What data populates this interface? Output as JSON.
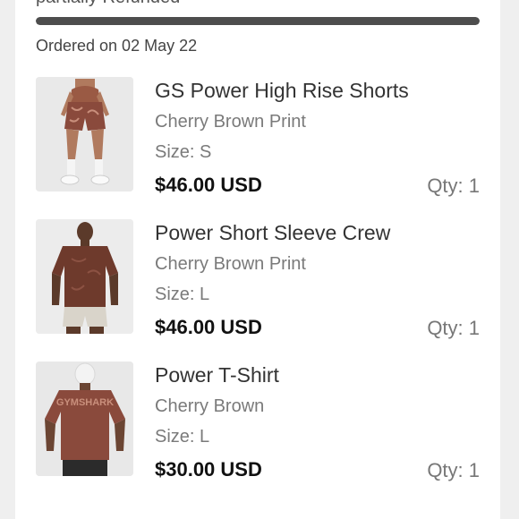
{
  "order": {
    "status_label": "partially Refunded",
    "progress_fraction": 1.0,
    "ordered_on": "Ordered on 02 May 22"
  },
  "items": [
    {
      "name": "GS Power High Rise Shorts",
      "color": "Cherry Brown Print",
      "size": "Size: S",
      "price": "$46.00 USD",
      "qty": "Qty: 1",
      "image": "product-image-shorts"
    },
    {
      "name": "Power Short Sleeve Crew",
      "color": "Cherry Brown Print",
      "size": "Size: L",
      "price": "$46.00 USD",
      "qty": "Qty: 1",
      "image": "product-image-crew"
    },
    {
      "name": "Power T-Shirt",
      "color": "Cherry Brown",
      "size": "Size: L",
      "price": "$30.00 USD",
      "qty": "Qty: 1",
      "image": "product-image-tshirt",
      "image_text": "GYMSHARK"
    }
  ],
  "colors": {
    "progress_fill": "#4d4d4d",
    "progress_track": "#dddddd",
    "product_brown": "#8a4a3c"
  }
}
